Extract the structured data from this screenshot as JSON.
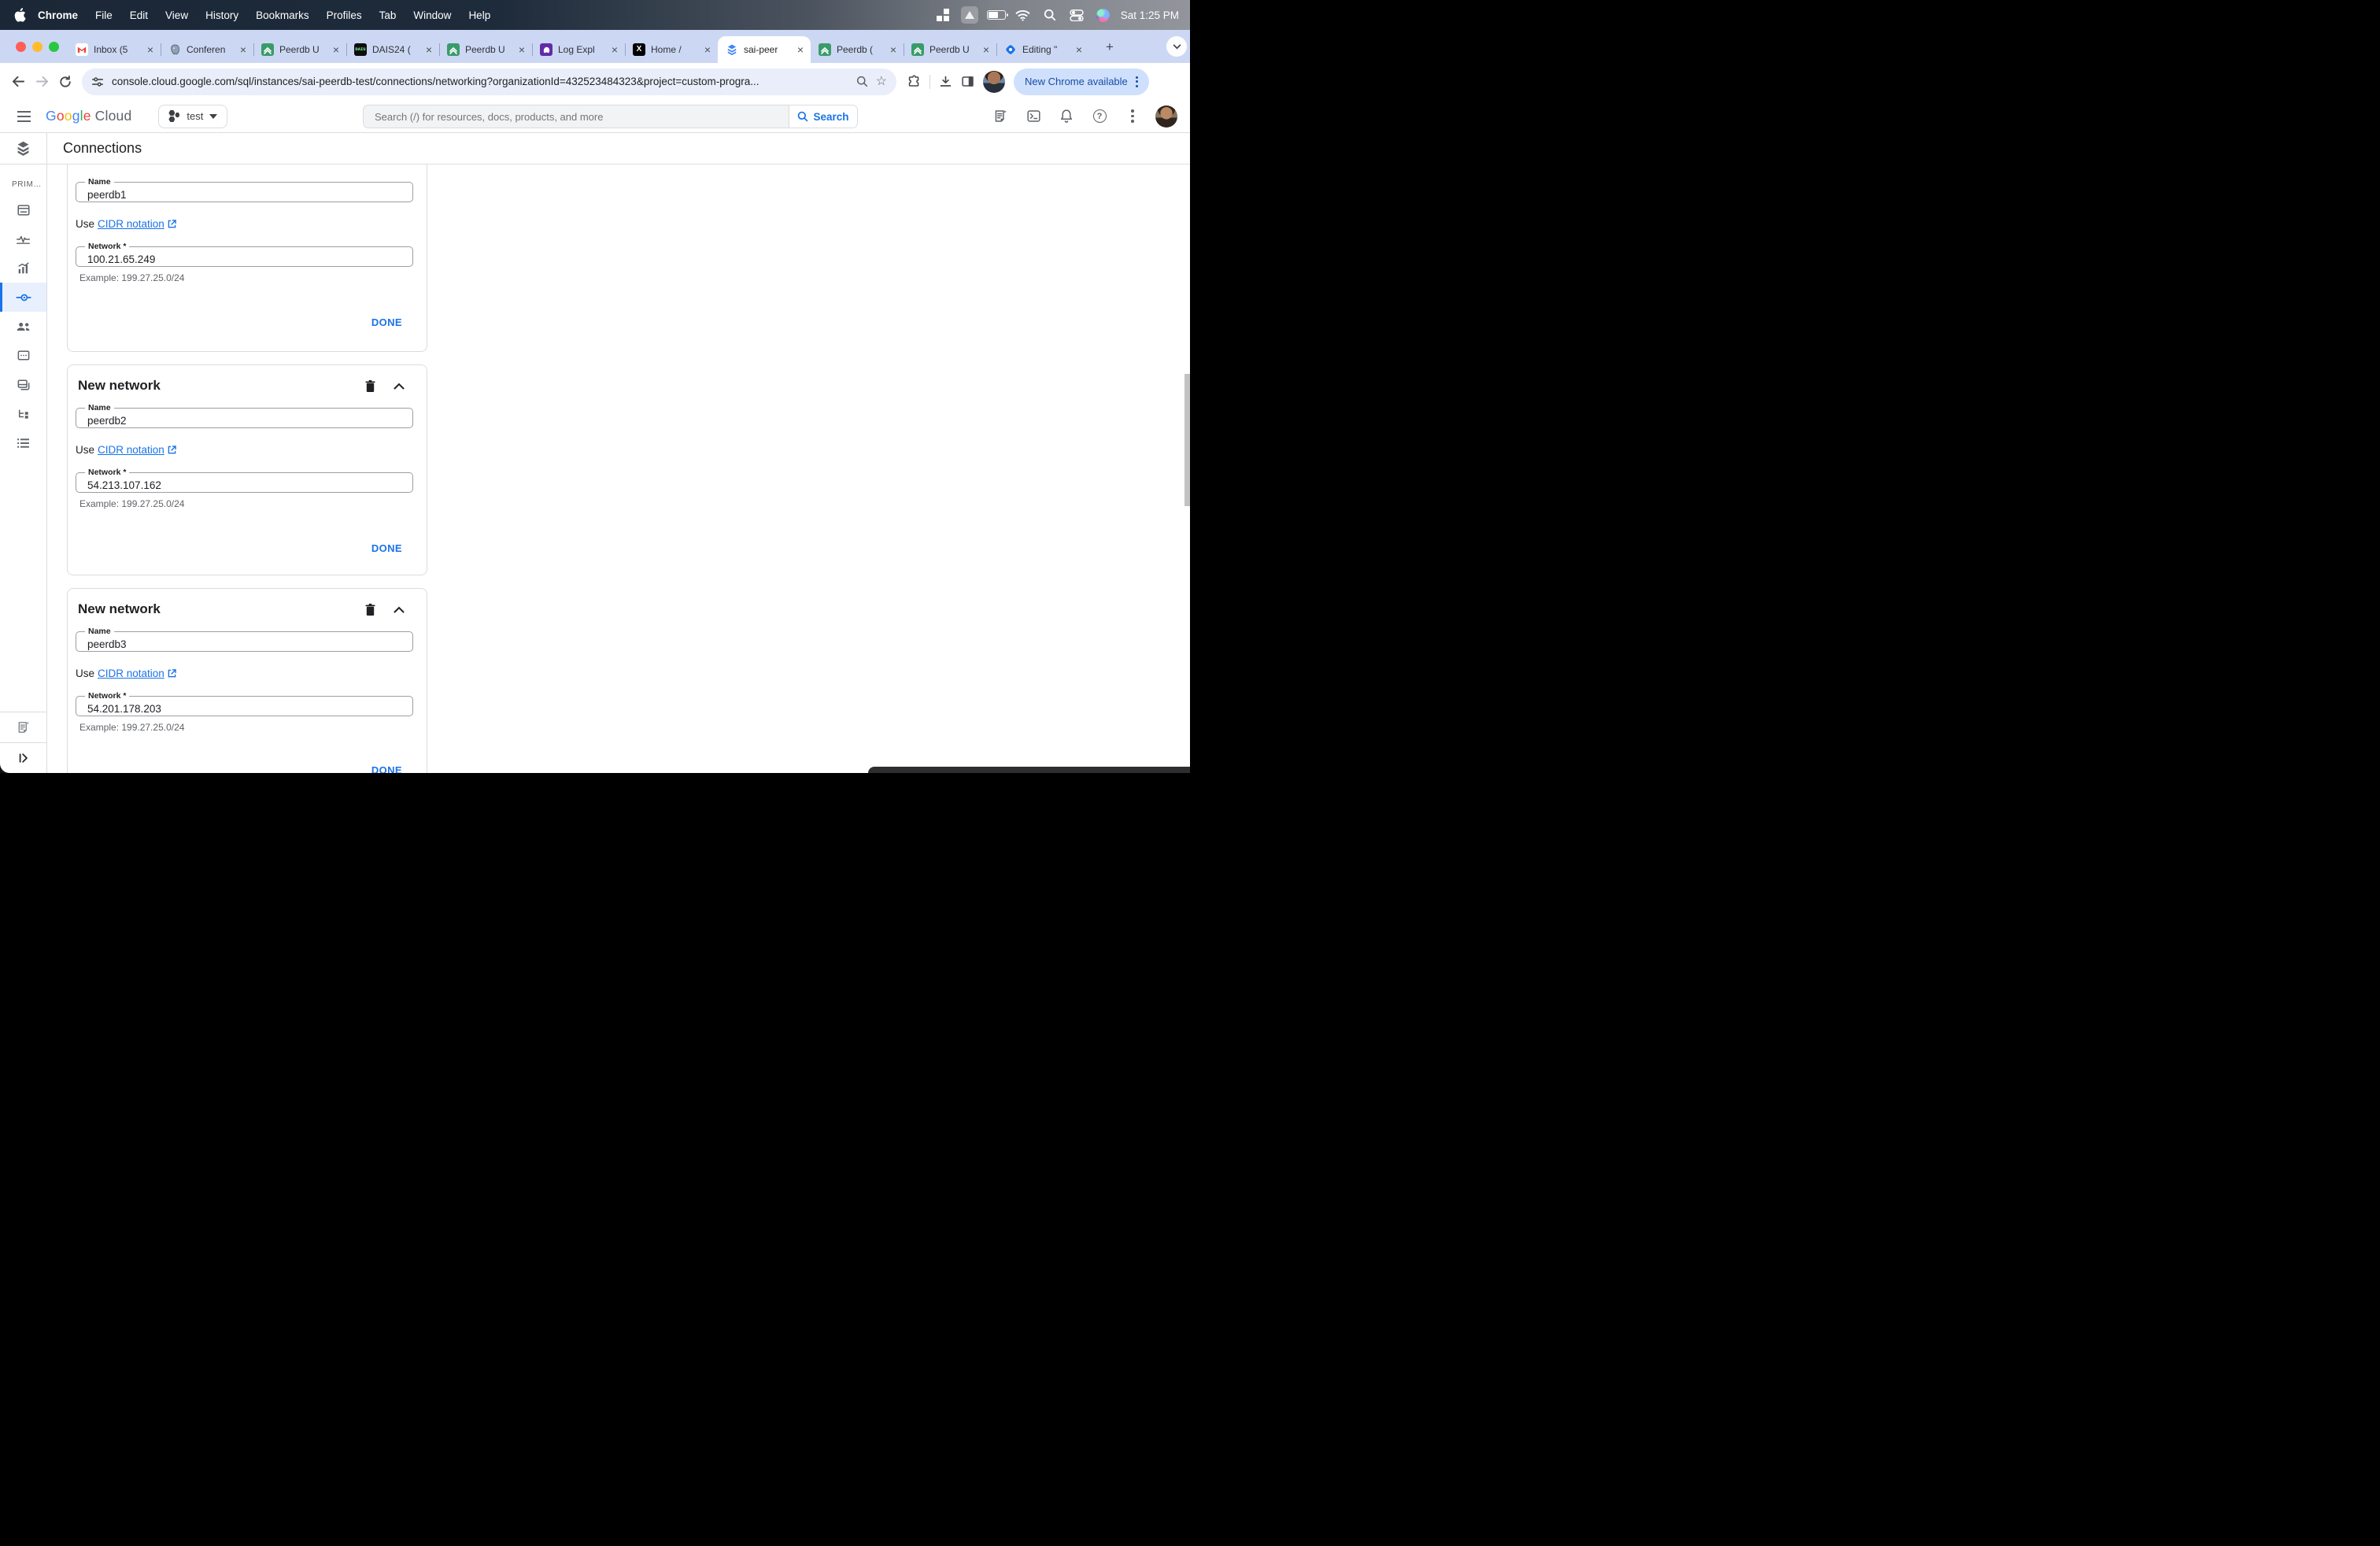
{
  "menubar": {
    "items": [
      "Chrome",
      "File",
      "Edit",
      "View",
      "History",
      "Bookmarks",
      "Profiles",
      "Tab",
      "Window",
      "Help"
    ],
    "clock": "Sat 1:25 PM"
  },
  "tabstrip": {
    "tabs": [
      {
        "title": "Inbox (5",
        "favicon": "gmail"
      },
      {
        "title": "Conferen",
        "favicon": "postgres"
      },
      {
        "title": "Peerdb U",
        "favicon": "peerdb"
      },
      {
        "title": "DAIS24 (",
        "favicon": "dais"
      },
      {
        "title": "Peerdb U",
        "favicon": "peerdb"
      },
      {
        "title": "Log Expl",
        "favicon": "log-explorer"
      },
      {
        "title": "Home /",
        "favicon": "x"
      },
      {
        "title": "sai-peer",
        "favicon": "cloud-sql"
      },
      {
        "title": "Peerdb (",
        "favicon": "peerdb"
      },
      {
        "title": "Peerdb U",
        "favicon": "peerdb"
      },
      {
        "title": "Editing \"",
        "favicon": "editing-pin"
      }
    ],
    "close_glyph": "×",
    "new_tab_glyph": "+",
    "dais_text": "DAIS"
  },
  "toolbar": {
    "url": "console.cloud.google.com/sql/instances/sai-peerdb-test/connections/networking?organizationId=432523484323&project=custom-progra...",
    "update_button": "New Chrome available"
  },
  "cloud_header": {
    "logo_letters": [
      "G",
      "o",
      "o",
      "g",
      "l",
      "e"
    ],
    "logo_cloud": "Cloud",
    "project_name": "test",
    "search_placeholder": "Search (/) for resources, docs, products, and more",
    "search_button": "Search"
  },
  "sidebar": {
    "section_label": "PRIM…"
  },
  "page": {
    "title": "Connections",
    "cards": [
      {
        "name_label": "Name",
        "name_value": "peerdb1",
        "use_prefix": "Use",
        "cidr_link": "CIDR notation",
        "network_label": "Network *",
        "network_value": "100.21.65.249",
        "example": "Example: 199.27.25.0/24",
        "done_label": "DONE"
      },
      {
        "heading": "New network",
        "name_label": "Name",
        "name_value": "peerdb2",
        "use_prefix": "Use",
        "cidr_link": "CIDR notation",
        "network_label": "Network *",
        "network_value": "54.213.107.162",
        "example": "Example: 199.27.25.0/24",
        "done_label": "DONE"
      },
      {
        "heading": "New network",
        "name_label": "Name",
        "name_value": "peerdb3",
        "use_prefix": "Use",
        "cidr_link": "CIDR notation",
        "network_label": "Network *",
        "network_value": "54.201.178.203",
        "example": "Example: 199.27.25.0/24",
        "done_label": "DONE"
      }
    ]
  },
  "colors": {
    "accent_blue": "#1a73e8",
    "google_blue": "#4285f4",
    "google_red": "#ea4335",
    "google_yellow": "#fbbc05",
    "google_green": "#34a853",
    "update_pill_bg": "#cfe0fc",
    "update_pill_text": "#174ea6",
    "tabstrip_bg": "#ccd8f3",
    "active_item_bg": "#e8f0fe"
  }
}
